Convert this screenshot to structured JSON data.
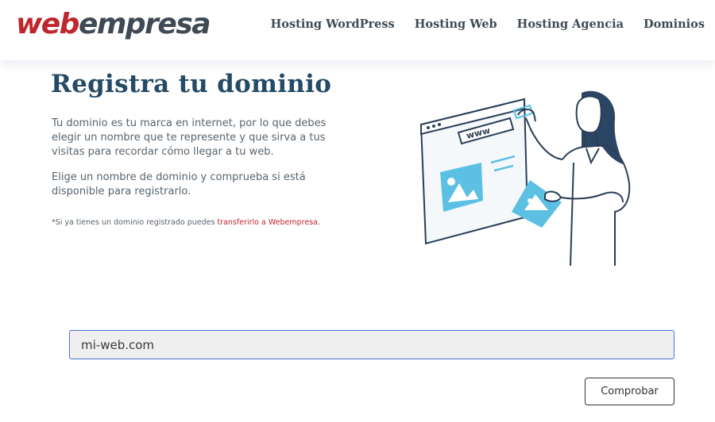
{
  "header": {
    "logo": {
      "part1": "web",
      "part2": "empresa"
    },
    "nav": [
      {
        "label": "Hosting WordPress"
      },
      {
        "label": "Hosting Web"
      },
      {
        "label": "Hosting Agencia"
      },
      {
        "label": "Dominios"
      }
    ]
  },
  "main": {
    "title": "Registra tu dominio",
    "paragraph1": "Tu dominio es tu marca en internet, por lo que debes elegir un nombre que te represente y que sirva a tus visitas para recordar cómo llegar a tu web.",
    "paragraph2": "Elige un nombre de dominio y comprueba si está disponible para registrarlo.",
    "note_prefix": "*Si ya tienes un dominio registrado puedes ",
    "note_link": "transferirlo a Webempresa",
    "note_suffix": ".",
    "illustration": {
      "www_label": "www",
      "icons": [
        "browser-window",
        "image-placeholder-icon",
        "woman-figure"
      ]
    }
  },
  "search": {
    "value": "mi-web.com",
    "button_label": "Comprobar"
  },
  "colors": {
    "brand_red": "#c0262d",
    "title_blue": "#244a66",
    "illustration_blue": "#5bc0e3",
    "input_border": "#4a74d6"
  }
}
